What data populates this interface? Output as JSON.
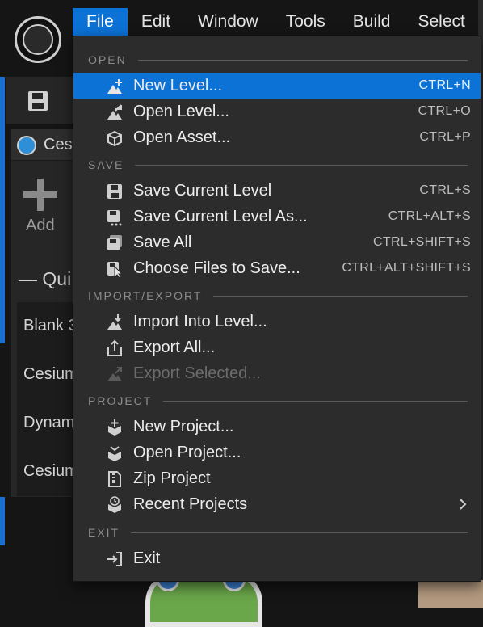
{
  "menubar": {
    "items": [
      {
        "label": "File",
        "active": true
      },
      {
        "label": "Edit"
      },
      {
        "label": "Window"
      },
      {
        "label": "Tools"
      },
      {
        "label": "Build"
      },
      {
        "label": "Select"
      }
    ]
  },
  "background": {
    "tab_label": "Cesi",
    "add_label": "Add",
    "quick_label": "— Qui",
    "quick_items": [
      "Blank 3",
      "Cesium",
      "Dynam",
      "Cesium"
    ]
  },
  "file_menu": {
    "sections": {
      "open": "OPEN",
      "save": "SAVE",
      "import_export": "IMPORT/EXPORT",
      "project": "PROJECT",
      "exit": "EXIT"
    },
    "items": {
      "new_level": {
        "label": "New Level...",
        "shortcut": "CTRL+N",
        "icon": "new-level-icon"
      },
      "open_level": {
        "label": "Open Level...",
        "shortcut": "CTRL+O",
        "icon": "open-level-icon"
      },
      "open_asset": {
        "label": "Open Asset...",
        "shortcut": "CTRL+P",
        "icon": "open-asset-icon"
      },
      "save_current_level": {
        "label": "Save Current Level",
        "shortcut": "CTRL+S",
        "icon": "save-icon"
      },
      "save_current_level_as": {
        "label": "Save Current Level As...",
        "shortcut": "CTRL+ALT+S",
        "icon": "save-as-icon"
      },
      "save_all": {
        "label": "Save All",
        "shortcut": "CTRL+SHIFT+S",
        "icon": "save-all-icon"
      },
      "choose_files": {
        "label": "Choose Files to Save...",
        "shortcut": "CTRL+ALT+SHIFT+S",
        "icon": "choose-files-icon"
      },
      "import_into_level": {
        "label": "Import Into Level...",
        "icon": "import-icon"
      },
      "export_all": {
        "label": "Export All...",
        "icon": "export-icon"
      },
      "export_selected": {
        "label": "Export Selected...",
        "icon": "export-selected-icon",
        "disabled": true
      },
      "new_project": {
        "label": "New Project...",
        "icon": "new-project-icon"
      },
      "open_project": {
        "label": "Open Project...",
        "icon": "open-project-icon"
      },
      "zip_project": {
        "label": "Zip Project",
        "icon": "zip-icon"
      },
      "recent_projects": {
        "label": "Recent Projects",
        "icon": "recent-projects-icon",
        "submenu": true
      },
      "exit": {
        "label": "Exit",
        "icon": "exit-icon"
      }
    }
  },
  "colors": {
    "accent": "#0c72d6",
    "menu_bg": "#2c2c2c",
    "text": "#ececec",
    "shortcut_text": "#bdbdbd",
    "disabled_text": "#6c6c6c",
    "section_text": "#8c8c8c"
  }
}
